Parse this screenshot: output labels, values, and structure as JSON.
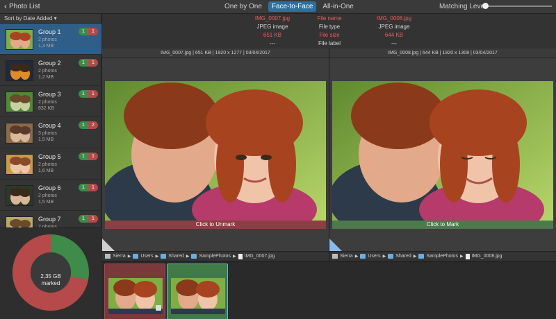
{
  "toolbar": {
    "back_label": "Photo List",
    "modes": [
      "One by One",
      "Face-to-Face",
      "All-in-One"
    ],
    "matching_label": "Matching Level:",
    "matching_level": 0
  },
  "sidebar": {
    "sort_label": "Sort by Date Added",
    "groups": [
      {
        "name": "Group 1",
        "count": "2 photos",
        "size": "1,3 MB",
        "green": "1",
        "red": "1"
      },
      {
        "name": "Group 2",
        "count": "2 photos",
        "size": "1,2 MB",
        "green": "1",
        "red": "1"
      },
      {
        "name": "Group 3",
        "count": "2 photos",
        "size": "832 KB",
        "green": "1",
        "red": "1"
      },
      {
        "name": "Group 4",
        "count": "3 photos",
        "size": "1,5 MB",
        "green": "1",
        "red": "2"
      },
      {
        "name": "Group 5",
        "count": "2 photos",
        "size": "1,6 MB",
        "green": "1",
        "red": "1"
      },
      {
        "name": "Group 6",
        "count": "2 photos",
        "size": "1,5 MB",
        "green": "1",
        "red": "1"
      },
      {
        "name": "Group 7",
        "count": "2 photos",
        "size": "1,5 MB",
        "green": "1",
        "red": "1"
      }
    ],
    "donut": {
      "size": "2,35 GB",
      "label": "marked",
      "marked_fraction": 0.72
    }
  },
  "compare": {
    "left_file": "IMG_0007.jpg",
    "right_file": "IMG_0008.jpg",
    "labels": [
      "File name",
      "File type",
      "File size",
      "File label"
    ],
    "left_values": [
      "IMG_0007.jpg",
      "JPEG image",
      "651 KB",
      "---"
    ],
    "right_values": [
      "IMG_0008.jpg",
      "JPEG image",
      "644 KB",
      "---"
    ],
    "left_header": "IMG_0007.jpg | 651 KB | 1920 x 1277 | 03/04/2017",
    "right_header": "IMG_0008.jpg | 644 KB | 1920 x 1308 | 03/04/2017",
    "left_action": "Click to Unmark",
    "right_action": "Click to Mark",
    "left_path": [
      "Sierra",
      "Users",
      "Shared",
      "SamplePhotos",
      "IMG_0007.jpg"
    ],
    "right_path": [
      "Sierra",
      "Users",
      "Shared",
      "SamplePhotos",
      "IMG_0008.jpg"
    ]
  },
  "colors": {
    "accent": "#2f6f9e",
    "marked": "#b6494a",
    "keep": "#3e8b4a"
  }
}
